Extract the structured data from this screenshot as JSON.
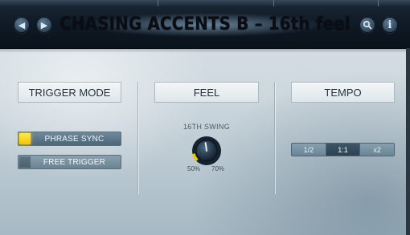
{
  "header": {
    "title": "CHASING ACCENTS B – 16th feel",
    "prev_icon": "chevron-left-icon",
    "next_icon": "chevron-right-icon",
    "search_icon": "search-icon",
    "info_icon": "info-icon",
    "prev_glyph": "◀",
    "next_glyph": "▶",
    "search_glyph": "⚲",
    "info_glyph": "i"
  },
  "sections": {
    "trigger_mode": {
      "label": "TRIGGER MODE",
      "options": [
        {
          "label": "PHRASE SYNC",
          "active": true
        },
        {
          "label": "FREE TRIGGER",
          "active": false
        }
      ]
    },
    "feel": {
      "label": "FEEL",
      "swing_label": "16TH SWING",
      "swing_min_label": "50%",
      "swing_max_label": "70%",
      "swing_value_fraction": 0.12
    },
    "tempo": {
      "label": "TEMPO",
      "options": [
        {
          "label": "1/2",
          "active": false
        },
        {
          "label": "1:1",
          "active": true
        },
        {
          "label": "x2",
          "active": false
        }
      ]
    }
  },
  "colors": {
    "accent_yellow": "#f3c400",
    "header_dark": "#0f1924",
    "button_blue": "#6f8a9c"
  }
}
